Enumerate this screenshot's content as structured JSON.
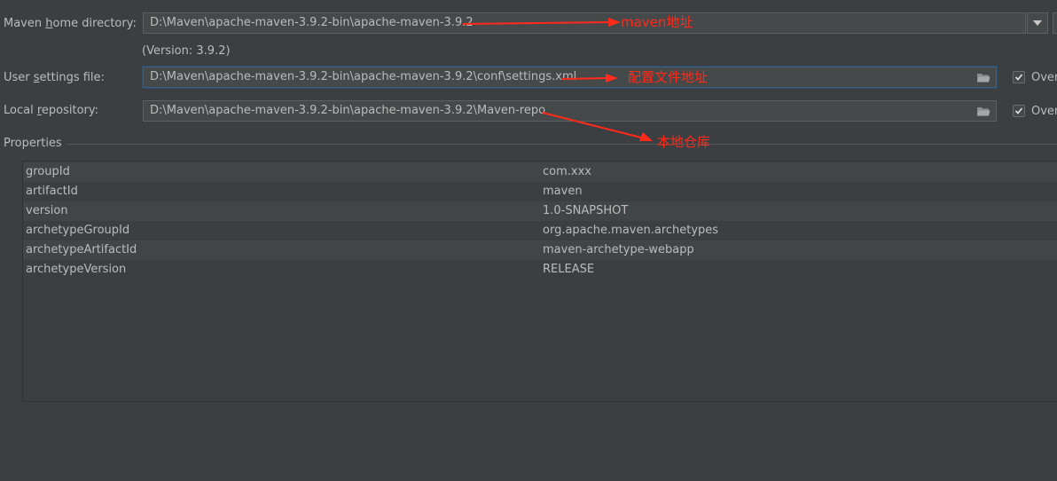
{
  "maven_home": {
    "label_pre": "Maven ",
    "label_mnemonic": "h",
    "label_post": "ome directory:",
    "value": "D:\\Maven\\apache-maven-3.9.2-bin\\apache-maven-3.9.2",
    "version": "(Version: 3.9.2)"
  },
  "user_settings": {
    "label_pre": "User ",
    "label_mnemonic": "s",
    "label_post": "ettings file:",
    "value": "D:\\Maven\\apache-maven-3.9.2-bin\\apache-maven-3.9.2\\conf\\settings.xml",
    "override_label": "Over",
    "override_checked": true
  },
  "local_repo": {
    "label_pre": "Local ",
    "label_mnemonic": "r",
    "label_post": "epository:",
    "value": "D:\\Maven\\apache-maven-3.9.2-bin\\apache-maven-3.9.2\\Maven-repo",
    "override_label": "Over",
    "override_checked": true
  },
  "properties": {
    "title": "Properties",
    "rows": [
      {
        "key": "groupId",
        "value": "com.xxx"
      },
      {
        "key": "artifactId",
        "value": "maven"
      },
      {
        "key": "version",
        "value": "1.0-SNAPSHOT"
      },
      {
        "key": "archetypeGroupId",
        "value": "org.apache.maven.archetypes"
      },
      {
        "key": "archetypeArtifactId",
        "value": "maven-archetype-webapp"
      },
      {
        "key": "archetypeVersion",
        "value": "RELEASE"
      }
    ]
  },
  "annotations": {
    "maven_address": "maven地址",
    "config_file": "配置文件地址",
    "local_repo": "本地仓库",
    "color": "#ff2a1a"
  },
  "icons": {
    "dropdown": "chevron-down-icon",
    "folder": "folder-icon",
    "checkbox": "checkmark-icon"
  }
}
